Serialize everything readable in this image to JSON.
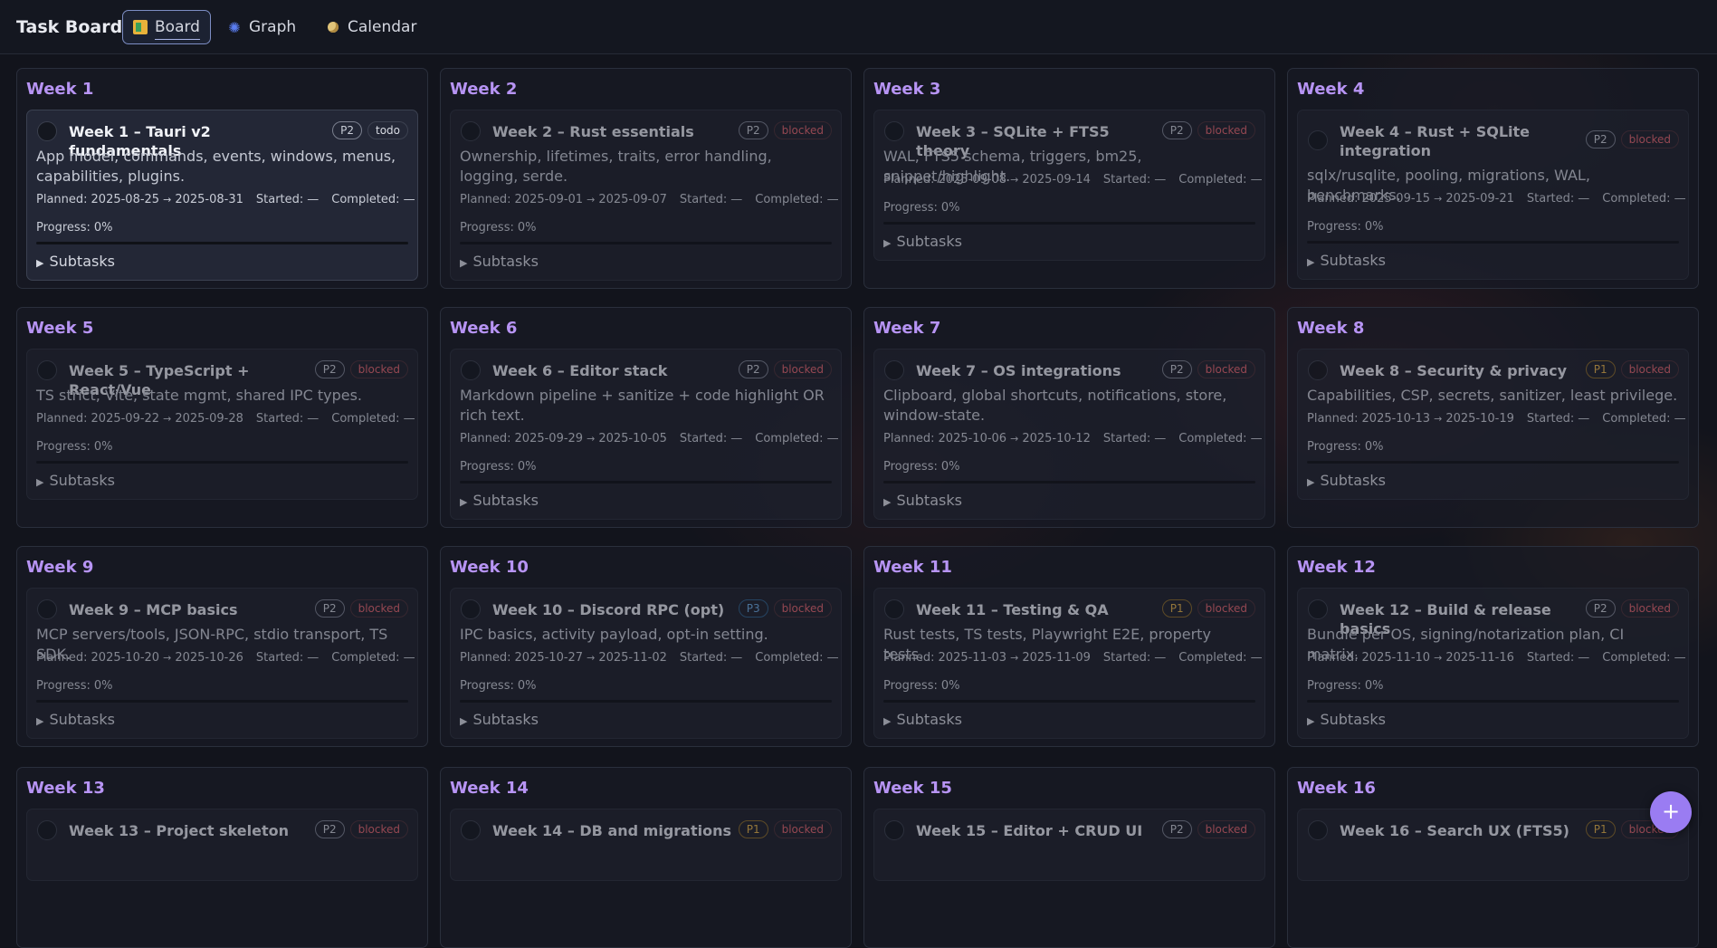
{
  "app": {
    "title": "Task Board"
  },
  "tabs": [
    {
      "label": "Board",
      "icon": "board-icon",
      "active": true
    },
    {
      "label": "Graph",
      "icon": "graph-icon"
    },
    {
      "label": "Calendar",
      "icon": "calendar-icon"
    }
  ],
  "labels": {
    "planned": "Planned:",
    "started": "Started:",
    "completed": "Completed:",
    "progress": "Progress:",
    "subtasks": "Subtasks",
    "arrow": "→",
    "dash": "—"
  },
  "weeks": [
    {
      "col": "Week 1",
      "title": "Week 1 – Tauri v2 fundamentals",
      "prio": "P2",
      "status": "todo",
      "desc": "App model, commands, events, windows, menus, capabilities, plugins.",
      "start": "2025-08-25",
      "end": "2025-08-31",
      "started": "—",
      "completed": "—",
      "progress": "0%"
    },
    {
      "col": "Week 2",
      "title": "Week 2 – Rust essentials",
      "prio": "P2",
      "status": "blocked",
      "desc": "Ownership, lifetimes, traits, error handling, logging, serde.",
      "start": "2025-09-01",
      "end": "2025-09-07",
      "started": "—",
      "completed": "—",
      "progress": "0%"
    },
    {
      "col": "Week 3",
      "title": "Week 3 – SQLite + FTS5 theory",
      "prio": "P2",
      "status": "blocked",
      "desc": "WAL, FTS5 schema, triggers, bm25, snippet/highlight.",
      "start": "2025-09-08",
      "end": "2025-09-14",
      "started": "—",
      "completed": "—",
      "progress": "0%"
    },
    {
      "col": "Week 4",
      "title": "Week 4 – Rust + SQLite integration",
      "prio": "P2",
      "status": "blocked",
      "desc": "sqlx/rusqlite, pooling, migrations, WAL, benchmarks.",
      "start": "2025-09-15",
      "end": "2025-09-21",
      "started": "—",
      "completed": "—",
      "progress": "0%"
    },
    {
      "col": "Week 5",
      "title": "Week 5 – TypeScript + React/Vue",
      "prio": "P2",
      "status": "blocked",
      "desc": "TS strict, Vite, state mgmt, shared IPC types.",
      "start": "2025-09-22",
      "end": "2025-09-28",
      "started": "—",
      "completed": "—",
      "progress": "0%"
    },
    {
      "col": "Week 6",
      "title": "Week 6 – Editor stack",
      "prio": "P2",
      "status": "blocked",
      "desc": "Markdown pipeline + sanitize + code highlight OR rich text.",
      "start": "2025-09-29",
      "end": "2025-10-05",
      "started": "—",
      "completed": "—",
      "progress": "0%"
    },
    {
      "col": "Week 7",
      "title": "Week 7 – OS integrations",
      "prio": "P2",
      "status": "blocked",
      "desc": "Clipboard, global shortcuts, notifications, store, window-state.",
      "start": "2025-10-06",
      "end": "2025-10-12",
      "started": "—",
      "completed": "—",
      "progress": "0%"
    },
    {
      "col": "Week 8",
      "title": "Week 8 – Security & privacy",
      "prio": "P1",
      "status": "blocked",
      "desc": "Capabilities, CSP, secrets, sanitizer, least privilege.",
      "start": "2025-10-13",
      "end": "2025-10-19",
      "started": "—",
      "completed": "—",
      "progress": "0%"
    },
    {
      "col": "Week 9",
      "title": "Week 9 – MCP basics",
      "prio": "P2",
      "status": "blocked",
      "desc": "MCP servers/tools, JSON-RPC, stdio transport, TS SDK.",
      "start": "2025-10-20",
      "end": "2025-10-26",
      "started": "—",
      "completed": "—",
      "progress": "0%"
    },
    {
      "col": "Week 10",
      "title": "Week 10 – Discord RPC (opt)",
      "prio": "P3",
      "status": "blocked",
      "desc": "IPC basics, activity payload, opt-in setting.",
      "start": "2025-10-27",
      "end": "2025-11-02",
      "started": "—",
      "completed": "—",
      "progress": "0%"
    },
    {
      "col": "Week 11",
      "title": "Week 11 – Testing & QA",
      "prio": "P1",
      "status": "blocked",
      "desc": "Rust tests, TS tests, Playwright E2E, property tests.",
      "start": "2025-11-03",
      "end": "2025-11-09",
      "started": "—",
      "completed": "—",
      "progress": "0%"
    },
    {
      "col": "Week 12",
      "title": "Week 12 – Build & release basics",
      "prio": "P2",
      "status": "blocked",
      "desc": "Bundle per OS, signing/notarization plan, CI matrix.",
      "start": "2025-11-10",
      "end": "2025-11-16",
      "started": "—",
      "completed": "—",
      "progress": "0%"
    },
    {
      "col": "Week 13",
      "title": "Week 13 – Project skeleton",
      "prio": "P2",
      "status": "blocked"
    },
    {
      "col": "Week 14",
      "title": "Week 14 – DB and migrations",
      "prio": "P1",
      "status": "blocked"
    },
    {
      "col": "Week 15",
      "title": "Week 15 – Editor + CRUD UI",
      "prio": "P2",
      "status": "blocked"
    },
    {
      "col": "Week 16",
      "title": "Week 16 – Search UX (FTS5)",
      "prio": "P1",
      "status": "blocked"
    }
  ],
  "fab": {
    "label": "+"
  },
  "colors": {
    "accent": "#b794f4",
    "blocked": "#e2646f",
    "p1": "#e2b04a",
    "p3": "#6aa8e0"
  }
}
